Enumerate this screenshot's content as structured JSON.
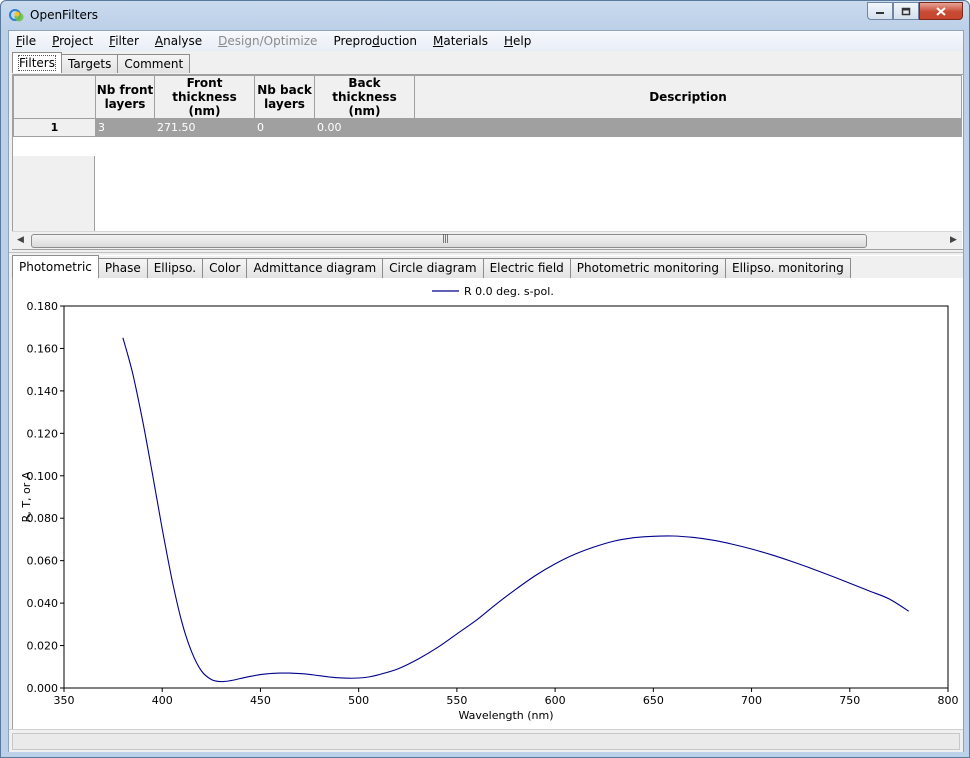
{
  "window": {
    "title": "OpenFilters",
    "icon": "openfilters-app-icon",
    "controls": {
      "minimize": "minimize-icon",
      "restore": "restore-icon",
      "close": "close-icon"
    }
  },
  "menu": [
    {
      "label": "File",
      "key": "F",
      "rest": "ile",
      "enabled": true
    },
    {
      "label": "Project",
      "key": "P",
      "rest": "roject",
      "enabled": true
    },
    {
      "label": "Filter",
      "key": "F",
      "rest": "ilter",
      "enabled": true
    },
    {
      "label": "Analyse",
      "key": "A",
      "rest": "nalyse",
      "enabled": true
    },
    {
      "label": "Design/Optimize",
      "key": "D",
      "rest": "esign/Optimize",
      "enabled": false
    },
    {
      "label": "Preproduction",
      "pre": "Prepro",
      "key": "d",
      "rest": "uction",
      "enabled": true
    },
    {
      "label": "Materials",
      "key": "M",
      "rest": "aterials",
      "enabled": true
    },
    {
      "label": "Help",
      "key": "H",
      "rest": "elp",
      "enabled": true
    }
  ],
  "top_tabs": {
    "filters": "Filters",
    "targets": "Targets",
    "comment": "Comment",
    "active": "Filters"
  },
  "grid": {
    "headers": {
      "nb_front": [
        "Nb front",
        "layers"
      ],
      "front_thickness": [
        "Front",
        "thickness (nm)"
      ],
      "nb_back": [
        "Nb back",
        "layers"
      ],
      "back_thickness": [
        "Back",
        "thickness (nm)"
      ],
      "description": "Description"
    },
    "rows": [
      {
        "index": "1",
        "nb_front": "3",
        "front_thickness": "271.50",
        "nb_back": "0",
        "back_thickness": "0.00",
        "description": ""
      }
    ]
  },
  "bottom_tabs": {
    "photometric": "Photometric",
    "phase": "Phase",
    "ellipso": "Ellipso.",
    "color": "Color",
    "admittance": "Admittance diagram",
    "circle": "Circle diagram",
    "electric": "Electric field",
    "phot_monitoring": "Photometric monitoring",
    "ellipso_monitoring": "Ellipso. monitoring",
    "active": "Photometric"
  },
  "chart_data": {
    "type": "line",
    "title": "",
    "xlabel": "Wavelength (nm)",
    "ylabel": "R, T, or A",
    "xlim": [
      350,
      800
    ],
    "ylim": [
      0,
      0.18
    ],
    "xticks": [
      350,
      400,
      450,
      500,
      550,
      600,
      650,
      700,
      750,
      800
    ],
    "xtick_labels": [
      "350",
      "400",
      "450",
      "500",
      "550",
      "600",
      "650",
      "700",
      "750",
      "800"
    ],
    "yticks": [
      0,
      0.02,
      0.04,
      0.06,
      0.08,
      0.1,
      0.12,
      0.14,
      0.16,
      0.18
    ],
    "ytick_labels": [
      "0.000",
      "0.020",
      "0.040",
      "0.060",
      "0.080",
      "0.100",
      "0.120",
      "0.140",
      "0.160",
      "0.180"
    ],
    "legend_position": "top-center",
    "grid": false,
    "series": [
      {
        "name": "R 0.0 deg. s-pol.",
        "color": "#00008b",
        "x": [
          380,
          385,
          390,
          395,
          400,
          405,
          410,
          415,
          420,
          425,
          430,
          435,
          440,
          445,
          450,
          455,
          460,
          465,
          470,
          475,
          480,
          485,
          490,
          495,
          500,
          505,
          510,
          520,
          530,
          540,
          550,
          560,
          570,
          580,
          590,
          600,
          610,
          620,
          630,
          640,
          650,
          660,
          670,
          680,
          690,
          700,
          710,
          720,
          730,
          740,
          750,
          760,
          770,
          780
        ],
        "y": [
          0.165,
          0.148,
          0.126,
          0.101,
          0.075,
          0.051,
          0.031,
          0.017,
          0.008,
          0.004,
          0.003,
          0.0035,
          0.0045,
          0.0055,
          0.0063,
          0.0068,
          0.007,
          0.007,
          0.0068,
          0.0064,
          0.0058,
          0.0052,
          0.0048,
          0.0046,
          0.0047,
          0.0052,
          0.0062,
          0.009,
          0.0135,
          0.019,
          0.0255,
          0.032,
          0.0395,
          0.0465,
          0.053,
          0.0585,
          0.063,
          0.0665,
          0.0692,
          0.0708,
          0.0715,
          0.0716,
          0.071,
          0.0697,
          0.0678,
          0.0655,
          0.0628,
          0.0598,
          0.0565,
          0.053,
          0.0494,
          0.0457,
          0.042,
          0.0362
        ]
      }
    ]
  }
}
